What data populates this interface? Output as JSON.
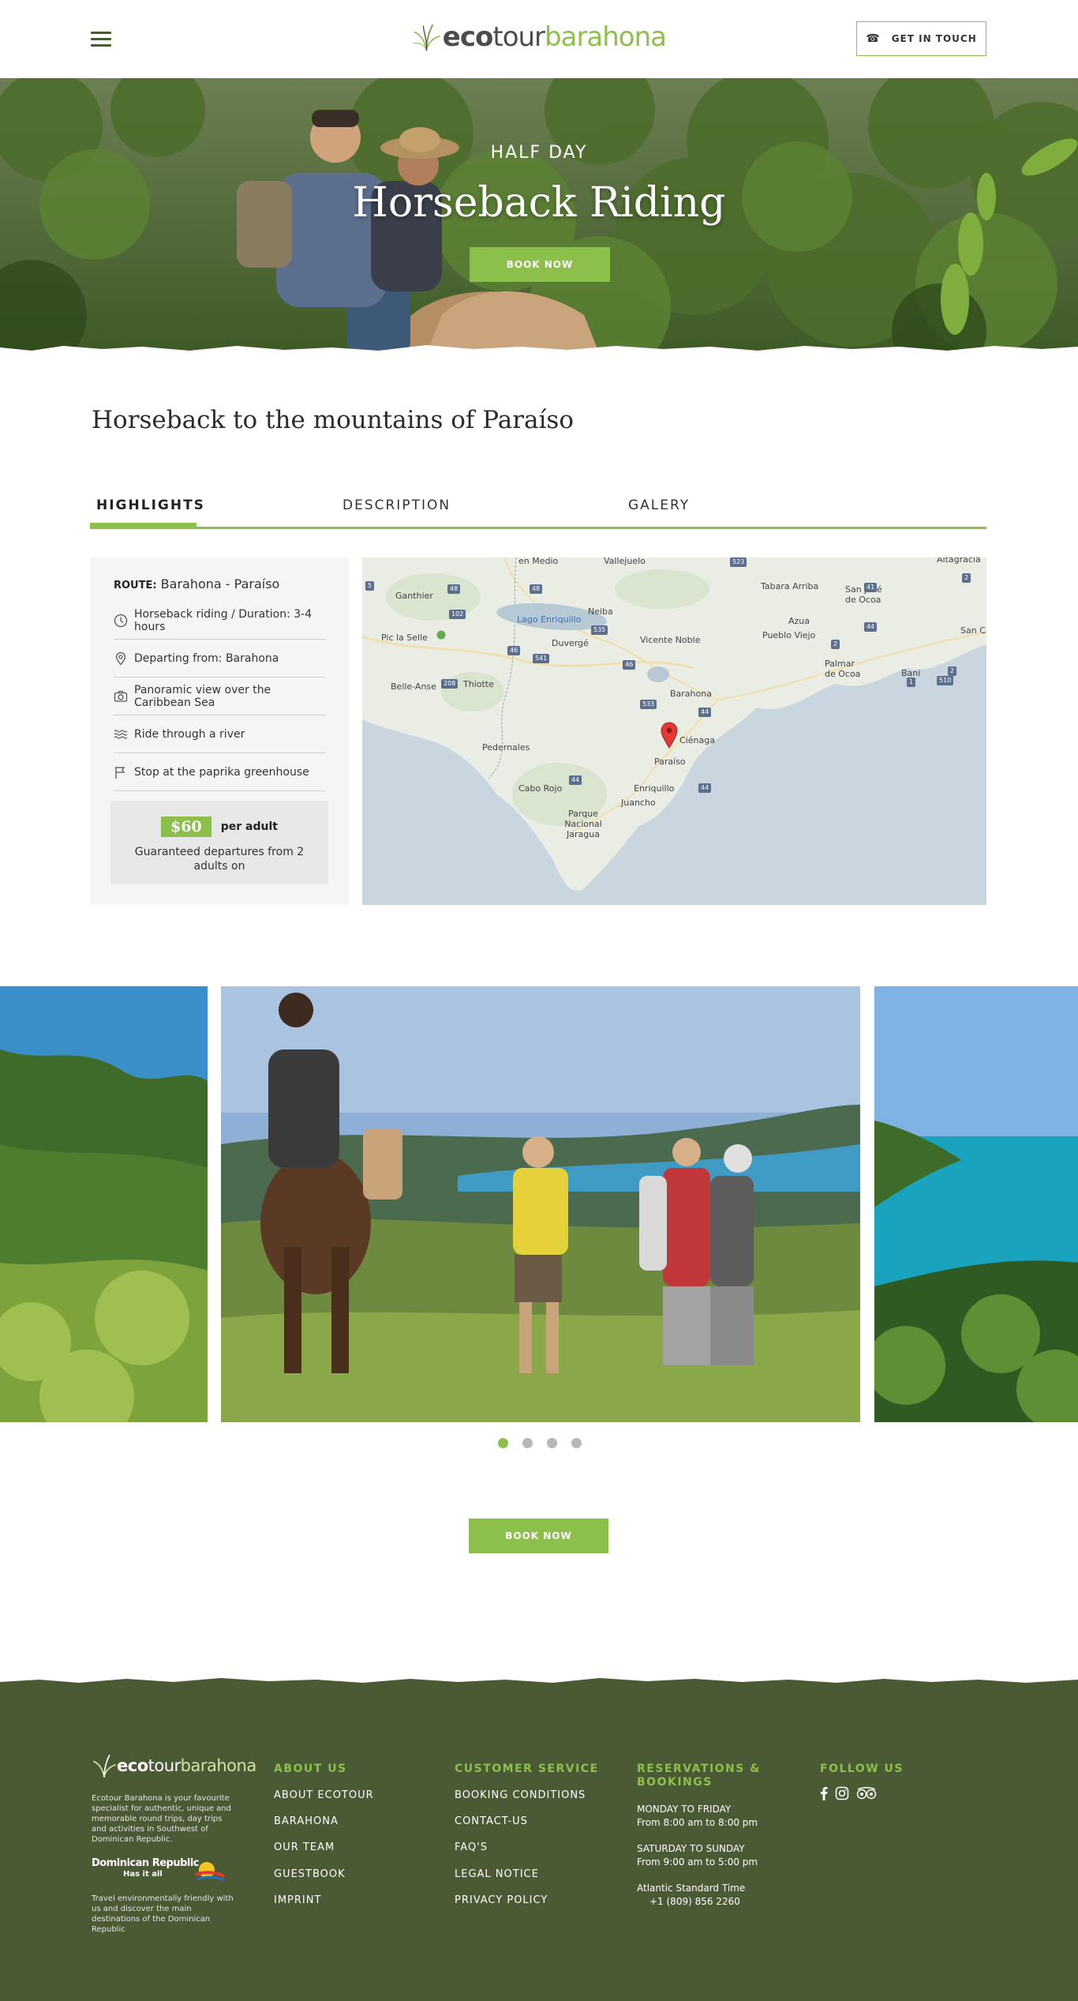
{
  "header": {
    "logo": {
      "eco": "eco",
      "tour": "tour",
      "barahona": "barahona"
    },
    "contact_label": "GET IN TOUCH"
  },
  "hero": {
    "subtitle": "HALF DAY",
    "title": "Horseback Riding",
    "book_label": "BOOK NOW"
  },
  "section": {
    "title": "Horseback to the mountains of Paraíso"
  },
  "tabs": [
    {
      "label": "HIGHLIGHTS",
      "active": true
    },
    {
      "label": "DESCRIPTION",
      "active": false
    },
    {
      "label": "GALERY",
      "active": false
    }
  ],
  "highlights": {
    "route_label": "ROUTE:",
    "route_value": "Barahona - Paraíso",
    "items": [
      {
        "icon": "clock-icon",
        "text": "Horseback riding / Duration: 3-4 hours"
      },
      {
        "icon": "location-pin-icon",
        "text": "Departing from: Barahona"
      },
      {
        "icon": "camera-icon",
        "text": "Panoramic view over the Caribbean Sea"
      },
      {
        "icon": "water-waves-icon",
        "text": "Ride through a river"
      },
      {
        "icon": "flag-icon",
        "text": "Stop at the paprika greenhouse"
      }
    ],
    "price": "$60",
    "per_adult": "per adult",
    "guaranteed": "Guaranteed departures from 2 adults on"
  },
  "map": {
    "labels": [
      "en Medio",
      "Vallejuelo",
      "Tabara Arriba",
      "San José de Ocoa",
      "Altagracia",
      "Ganthier",
      "Neiba",
      "Lago Enriquillo",
      "Azua",
      "Pueblo Viejo",
      "San Cris",
      "Pic la Selle",
      "Duvergé",
      "Vicente Noble",
      "Palmar de Ocoa",
      "Bani",
      "Belle-Anse",
      "Thiotte",
      "Barahona",
      "Ciénaga",
      "Pedernales",
      "Paraíso",
      "Cabo Rojo",
      "Enriquillo",
      "Juancho",
      "Parque Nacional Jaragua"
    ],
    "route_numbers": [
      "523",
      "48",
      "48",
      "41",
      "2",
      "44",
      "102",
      "535",
      "541",
      "46",
      "46",
      "2",
      "1",
      "510",
      "2",
      "208",
      "533",
      "44",
      "44",
      "44",
      "5"
    ]
  },
  "gallery": {
    "dots": [
      {
        "active": true
      },
      {
        "active": false
      },
      {
        "active": false
      },
      {
        "active": false
      }
    ]
  },
  "book_now": "BOOK NOW",
  "footer": {
    "logo": {
      "eco": "eco",
      "tour": "tour",
      "barahona": "barahona"
    },
    "description": "Ecotour Barahona is your favourite specialist for authentic, unique and memorable round trips, day trips and activities in Southwest of Dominican Republic.",
    "dr_logo_line1": "Dominican Republic",
    "dr_logo_line2": "Has it all",
    "description2": "Travel environmentally friendly with us and discover the main destinations of the Dominican Republic",
    "about_us": {
      "heading": "ABOUT US",
      "links": [
        "ABOUT ECOTOUR",
        "BARAHONA",
        "OUR TEAM",
        "GUESTBOOK",
        "IMPRINT"
      ]
    },
    "customer_service": {
      "heading": "CUSTOMER SERVICE",
      "links": [
        "BOOKING CONDITIONS",
        "CONTACT-US",
        "FAQ'S",
        "LEGAL NOTICE",
        "PRIVACY POLICY"
      ]
    },
    "reservations": {
      "heading": "RESERVATIONS & BOOKINGS",
      "weekday_label": "MONDAY TO FRIDAY",
      "weekday_hours": "From 8:00 am to 8:00 pm",
      "weekend_label": "SATURDAY TO SUNDAY",
      "weekend_hours": "From 9:00 am to 5:00 pm",
      "timezone": "Atlantic Standard Time",
      "phone": "+1 (809) 856 2260"
    },
    "follow_us": {
      "heading": "FOLLOW US",
      "icons": [
        "facebook-icon",
        "instagram-icon",
        "tripadvisor-icon"
      ]
    }
  }
}
